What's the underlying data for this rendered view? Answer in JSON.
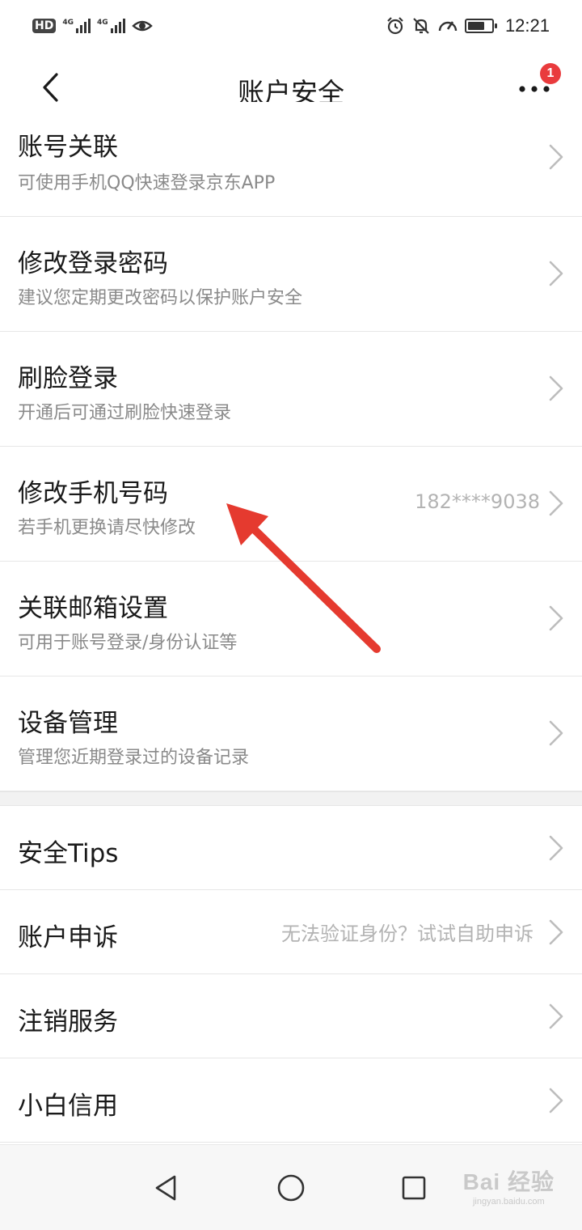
{
  "status_bar": {
    "hd": "HD",
    "net1": "4G",
    "net2": "4G",
    "time": "12:21",
    "battery_level": 0.7
  },
  "nav": {
    "title": "账户安全",
    "badge": "1"
  },
  "rows": [
    {
      "title": "账号关联",
      "sub": "可使用手机QQ快速登录京东APP"
    },
    {
      "title": "修改登录密码",
      "sub": "建议您定期更改密码以保护账户安全"
    },
    {
      "title": "刷脸登录",
      "sub": "开通后可通过刷脸快速登录"
    },
    {
      "title": "修改手机号码",
      "sub": "若手机更换请尽快修改",
      "value": "182****9038"
    },
    {
      "title": "关联邮箱设置",
      "sub": "可用于账号登录/身份认证等"
    },
    {
      "title": "设备管理",
      "sub": "管理您近期登录过的设备记录"
    }
  ],
  "rows2": [
    {
      "title": "安全Tips"
    },
    {
      "title": "账户申诉",
      "value": "无法验证身份？试试自助申诉"
    },
    {
      "title": "注销服务"
    },
    {
      "title": "小白信用"
    }
  ],
  "watermark": {
    "main": "Bai 经验",
    "sub": "jingyan.baidu.com"
  },
  "colors": {
    "accent": "#e93b3d",
    "annotation_arrow": "#e53a2f"
  }
}
